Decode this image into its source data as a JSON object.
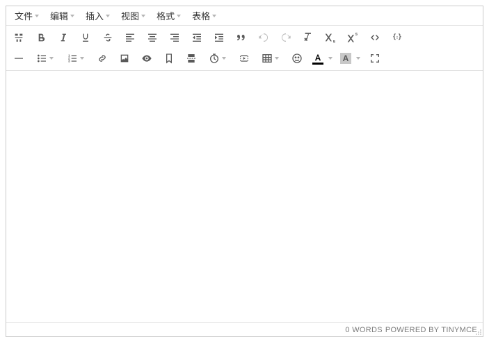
{
  "menubar": {
    "items": [
      {
        "label": "文件"
      },
      {
        "label": "编辑"
      },
      {
        "label": "插入"
      },
      {
        "label": "视图"
      },
      {
        "label": "格式"
      },
      {
        "label": "表格"
      }
    ]
  },
  "status": {
    "words_count": 0,
    "words_label": "WORDS",
    "powered_label": "POWERED BY TINYMCE"
  },
  "colors": {
    "text": "#000000",
    "highlight": "#c8c8c8"
  }
}
